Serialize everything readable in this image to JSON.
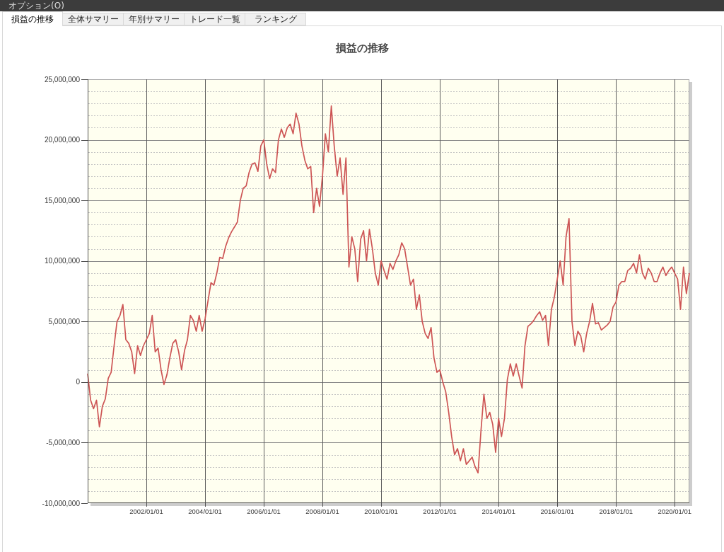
{
  "menu_bar": {
    "items": [
      {
        "label": "オプション(O)"
      }
    ]
  },
  "tabs": [
    {
      "label": "損益の推移",
      "selected": true
    },
    {
      "label": "全体サマリー",
      "selected": false
    },
    {
      "label": "年別サマリー",
      "selected": false
    },
    {
      "label": "トレード一覧",
      "selected": false
    },
    {
      "label": "ランキング",
      "selected": false
    }
  ],
  "chart": {
    "chart_data": {
      "type": "line",
      "title": "損益の推移",
      "grid": true,
      "categories": [
        null,
        null,
        null,
        null,
        null,
        null,
        null,
        null,
        null,
        null,
        null,
        null,
        null,
        null,
        null,
        null,
        null,
        null,
        null,
        null,
        "2002/01/01",
        null,
        null,
        null,
        null,
        null,
        null,
        null,
        null,
        null,
        null,
        null,
        null,
        null,
        null,
        null,
        null,
        null,
        null,
        null,
        "2004/01/01",
        null,
        null,
        null,
        null,
        null,
        null,
        null,
        null,
        null,
        null,
        null,
        null,
        null,
        null,
        null,
        null,
        null,
        null,
        null,
        "2006/01/01",
        null,
        null,
        null,
        null,
        null,
        null,
        null,
        null,
        null,
        null,
        null,
        null,
        null,
        null,
        null,
        null,
        null,
        null,
        null,
        "2008/01/01",
        null,
        null,
        null,
        null,
        null,
        null,
        null,
        null,
        null,
        null,
        null,
        null,
        null,
        null,
        null,
        null,
        null,
        null,
        null,
        "2010/01/01",
        null,
        null,
        null,
        null,
        null,
        null,
        null,
        null,
        null,
        null,
        null,
        null,
        null,
        null,
        null,
        null,
        null,
        null,
        null,
        "2012/01/01",
        null,
        null,
        null,
        null,
        null,
        null,
        null,
        null,
        null,
        null,
        null,
        null,
        null,
        null,
        null,
        null,
        null,
        null,
        null,
        "2014/01/01",
        null,
        null,
        null,
        null,
        null,
        null,
        null,
        null,
        null,
        null,
        null,
        null,
        null,
        null,
        null,
        null,
        null,
        null,
        null,
        "2016/01/01",
        null,
        null,
        null,
        null,
        null,
        null,
        null,
        null,
        null,
        null,
        null,
        null,
        null,
        null,
        null,
        null,
        null,
        null,
        null,
        "2018/01/01",
        null,
        null,
        null,
        null,
        null,
        null,
        null,
        null,
        null,
        null,
        null,
        null,
        null,
        null,
        null,
        null,
        null,
        null,
        null,
        "2020/01/01",
        null,
        null,
        null,
        null,
        null
      ],
      "series": [
        {
          "color": "#cd5555",
          "values": [
            700000,
            -1500000,
            -2200000,
            -1500000,
            -3700000,
            -2000000,
            -1400000,
            300000,
            800000,
            3000000,
            5000000,
            5500000,
            6400000,
            3500000,
            3200000,
            2500000,
            700000,
            3000000,
            2200000,
            3000000,
            3500000,
            4000000,
            5500000,
            2500000,
            2800000,
            1000000,
            -200000,
            600000,
            2000000,
            3200000,
            3500000,
            2500000,
            1000000,
            2600000,
            3500000,
            5500000,
            5100000,
            4200000,
            5500000,
            4200000,
            5200000,
            6700000,
            8200000,
            8000000,
            9000000,
            10300000,
            10200000,
            11200000,
            11900000,
            12400000,
            12800000,
            13200000,
            15000000,
            16000000,
            16200000,
            17300000,
            18000000,
            18100000,
            17400000,
            19500000,
            20000000,
            18000000,
            16800000,
            17600000,
            17300000,
            20000000,
            20900000,
            20200000,
            21000000,
            21300000,
            20500000,
            22200000,
            21300000,
            19500000,
            18300000,
            17600000,
            17800000,
            14000000,
            16000000,
            14500000,
            17000000,
            20500000,
            19000000,
            22800000,
            19500000,
            17000000,
            18500000,
            15500000,
            18500000,
            9500000,
            12000000,
            11000000,
            8300000,
            11800000,
            12500000,
            10000000,
            12600000,
            11000000,
            9000000,
            8000000,
            10000000,
            9200000,
            8500000,
            9800000,
            9300000,
            10000000,
            10500000,
            11500000,
            11000000,
            9500000,
            8000000,
            8500000,
            6000000,
            7200000,
            5000000,
            4000000,
            3600000,
            4500000,
            2000000,
            800000,
            1000000,
            0,
            -800000,
            -2500000,
            -4500000,
            -6000000,
            -5500000,
            -6500000,
            -5500000,
            -6800000,
            -6500000,
            -6200000,
            -7000000,
            -7500000,
            -4000000,
            -1000000,
            -3000000,
            -2500000,
            -3500000,
            -5800000,
            -3000000,
            -4500000,
            -3000000,
            200000,
            1500000,
            500000,
            1500000,
            500000,
            -500000,
            3000000,
            4600000,
            4800000,
            5100000,
            5500000,
            5800000,
            5100000,
            5500000,
            3000000,
            6000000,
            7000000,
            8500000,
            10000000,
            8000000,
            12000000,
            13500000,
            5000000,
            3000000,
            4200000,
            3800000,
            2500000,
            4000000,
            5000000,
            6500000,
            4800000,
            4900000,
            4300000,
            4500000,
            4700000,
            5000000,
            6200000,
            6600000,
            8000000,
            8300000,
            8300000,
            9200000,
            9400000,
            9800000,
            9000000,
            10500000,
            9000000,
            8500000,
            9400000,
            9000000,
            8300000,
            8300000,
            9000000,
            9500000,
            8800000,
            9200000,
            9500000,
            9000000,
            8500000,
            6000000,
            9500000,
            7300000,
            9000000
          ]
        }
      ],
      "ylim": [
        -10000000,
        25000000
      ],
      "yticks": [
        {
          "value": -10000000,
          "label": "-10,000,000"
        },
        {
          "value": -5000000,
          "label": "-5,000,000"
        },
        {
          "value": 0,
          "label": "0"
        },
        {
          "value": 5000000,
          "label": "5,000,000"
        },
        {
          "value": 10000000,
          "label": "10,000,000"
        },
        {
          "value": 15000000,
          "label": "15,000,000"
        },
        {
          "value": 20000000,
          "label": "20,000,000"
        },
        {
          "value": 25000000,
          "label": "25,000,000"
        }
      ]
    }
  }
}
